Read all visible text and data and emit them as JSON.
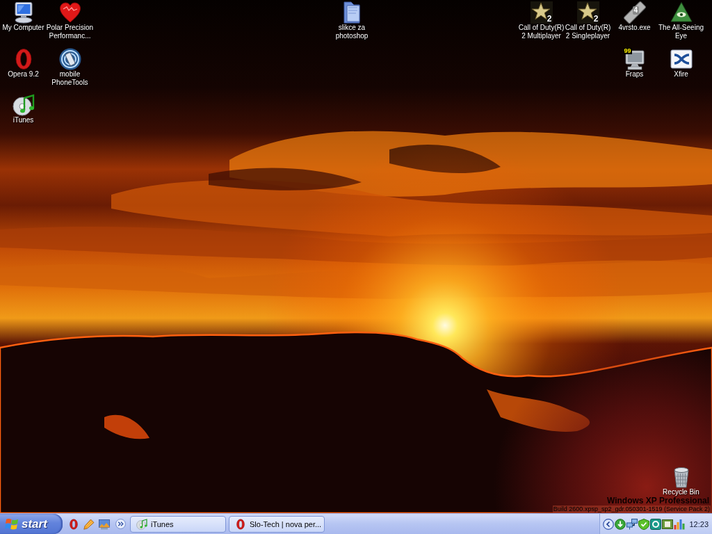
{
  "desktop": {
    "top_left_icons": [
      [
        {
          "label": "My Computer",
          "kind": "computer"
        },
        {
          "label": "Opera 9.2",
          "kind": "opera"
        },
        {
          "label": "iTunes",
          "kind": "itunes"
        }
      ],
      [
        {
          "label": "Polar Precision Performanc...",
          "kind": "heart"
        },
        {
          "label": "mobile PhoneTools",
          "kind": "phone"
        }
      ]
    ],
    "top_center_icons": [
      [
        {
          "label": "slikce za photoshop",
          "kind": "folder"
        }
      ]
    ],
    "top_right_icons": [
      [
        {
          "label": "Call of Duty(R) 2 Multiplayer",
          "kind": "star",
          "badge": "2"
        }
      ],
      [
        {
          "label": "Call of Duty(R) 2 Singleplayer",
          "kind": "star",
          "badge": "2"
        }
      ],
      [
        {
          "label": "4vrsto.exe",
          "kind": "stick",
          "badge": "4"
        },
        {
          "label": "Fraps",
          "kind": "monitor",
          "badge": "99"
        }
      ],
      [
        {
          "label": "The All-Seeing Eye",
          "kind": "pyramid"
        },
        {
          "label": "Xfire",
          "kind": "xlogo"
        }
      ]
    ],
    "bottom_right_icons": [
      [
        {
          "label": "Recycle Bin",
          "kind": "bin"
        }
      ]
    ],
    "edition_text": "Windows XP Professional",
    "build_text": "Build 2600.xpsp_sp2_gdr.050301-1519 (Service Pack 2)"
  },
  "taskbar": {
    "start_label": "start",
    "tasks": [
      {
        "label": "iTunes",
        "kind": "itunes",
        "selected": false
      },
      {
        "label": "Slo-Tech | nova per...",
        "kind": "opera",
        "selected": false
      }
    ],
    "clock": "12:23"
  }
}
